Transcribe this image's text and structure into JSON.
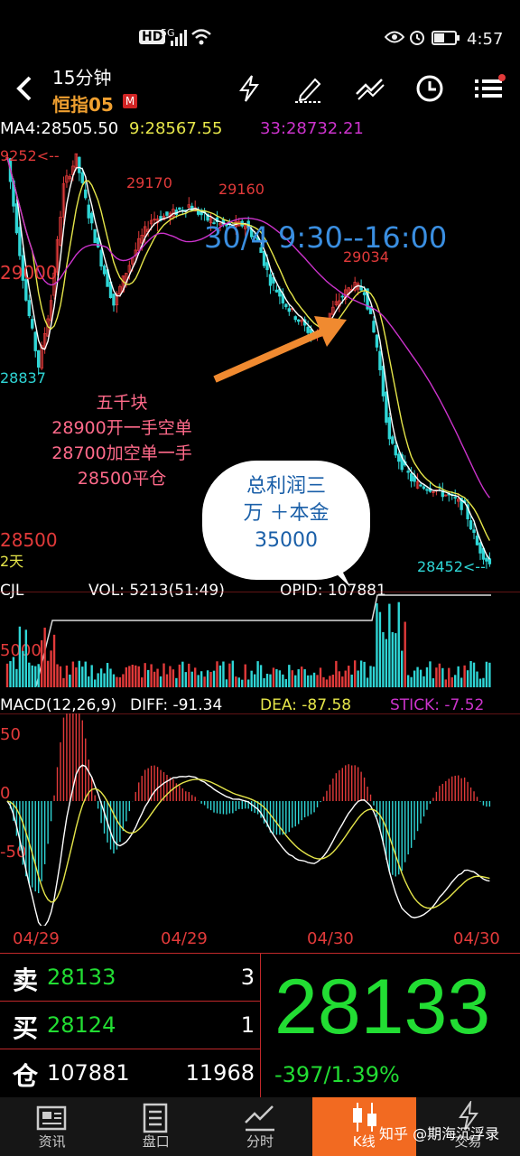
{
  "status_bar": {
    "network": "HD",
    "signal_label": "5G",
    "time": "4:57"
  },
  "header": {
    "period": "15分钟",
    "symbol": "恒指05",
    "symbol_badge": "M",
    "icons": [
      "back-icon",
      "lightning-icon",
      "draw-pen-icon",
      "trend-lines-icon",
      "clock-icon",
      "menu-icon"
    ]
  },
  "ma_line": {
    "ma4": "MA4:28505.50",
    "ma9": "9:28567.55",
    "ma33": "33:28732.21"
  },
  "chart_labels": {
    "hi_left": "9252<--",
    "p29170": "29170",
    "p29160": "29160",
    "p29000": "29000",
    "p29034": "29034",
    "p28837": "28837",
    "p28500": "28500",
    "days": "2天",
    "p28452": "28452<--",
    "date_range": "30/4 9:30--16:00"
  },
  "notes": {
    "line1": "五千块",
    "line2": "28900开一手空单",
    "line3": "28700加空单一手",
    "line4": "28500平仓"
  },
  "bubble": {
    "line1": "总利润三",
    "line2": "万 ＋本金",
    "line3": "35000"
  },
  "volume": {
    "title": "CJL",
    "vol": "VOL: 5213(51:49)",
    "opid": "OPID: 107881",
    "axis_label": "5000"
  },
  "macd": {
    "title": "MACD(12,26,9)",
    "diff": "DIFF: -91.34",
    "dea": "DEA: -87.58",
    "stick": "STICK: -7.52",
    "axis_top": "50",
    "axis_mid": "0",
    "axis_bottom": "-50"
  },
  "dates": [
    "04/29",
    "04/29",
    "04/30",
    "04/30"
  ],
  "quote": {
    "sell_label": "卖",
    "sell_price": "28133",
    "sell_qty": "3",
    "buy_label": "买",
    "buy_price": "28124",
    "buy_qty": "1",
    "oi_label": "仓",
    "oi_value": "107881",
    "oi_qty": "11968",
    "last_price": "28133",
    "change": "-397/1.39%"
  },
  "nav": [
    {
      "label": "资讯",
      "icon": "news-icon"
    },
    {
      "label": "盘口",
      "icon": "orderbook-icon"
    },
    {
      "label": "分时",
      "icon": "timeshare-icon"
    },
    {
      "label": "K线",
      "icon": "candlestick-icon"
    },
    {
      "label": "交易",
      "icon": "trade-icon"
    }
  ],
  "watermark": "知乎 @期海沉浮录",
  "colors": {
    "up": "#e23a3a",
    "down": "#2fd6d6",
    "ma4": "#ffffff",
    "ma9": "#e6e64a",
    "ma33": "#cc33cc",
    "accent": "#f26a21",
    "price_green": "#22dd33"
  }
}
